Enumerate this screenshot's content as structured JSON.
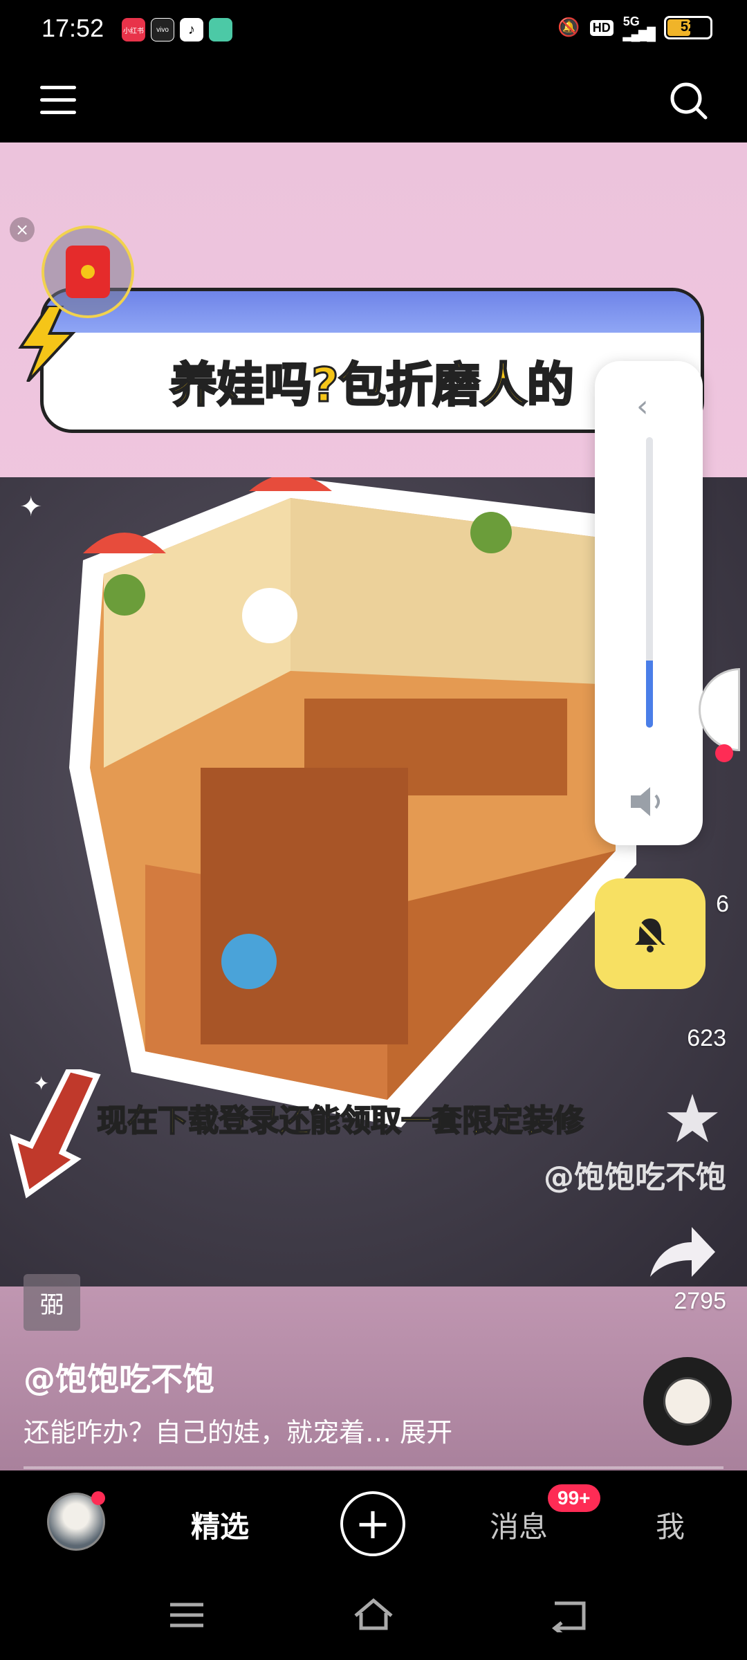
{
  "status_bar": {
    "time": "17:52",
    "apps": [
      "小红书",
      "vivo",
      "抖音",
      "app"
    ],
    "hd": "HD",
    "network": "5G",
    "battery": "52",
    "battery_level": 0.52
  },
  "top_nav": {
    "menu_icon": "hamburger-menu-icon",
    "search_icon": "search-icon"
  },
  "video": {
    "banner_title": "养娃吗?包折磨人的",
    "caption": "现在下载登录还能领取一套限定装修",
    "watermark": "@饱饱吃不饱",
    "label_chip": "弼",
    "author": "@饱饱吃不饱",
    "description": "还能咋办？自己的娃，就宠着… 展开"
  },
  "volume_panel": {
    "level": 0.23,
    "chevron": "‹"
  },
  "side_actions": {
    "comment_count": "623",
    "share_count": "2795",
    "like_count_partial": "6"
  },
  "bottom_nav": {
    "featured": "精选",
    "plus": "+",
    "messages": "消息",
    "messages_badge": "99+",
    "me": "我"
  },
  "colors": {
    "accent_red": "#fe2c55",
    "volume_blue": "#4a7ee8",
    "mute_yellow": "#f7e062",
    "caption_yellow": "#ffdf2c"
  }
}
